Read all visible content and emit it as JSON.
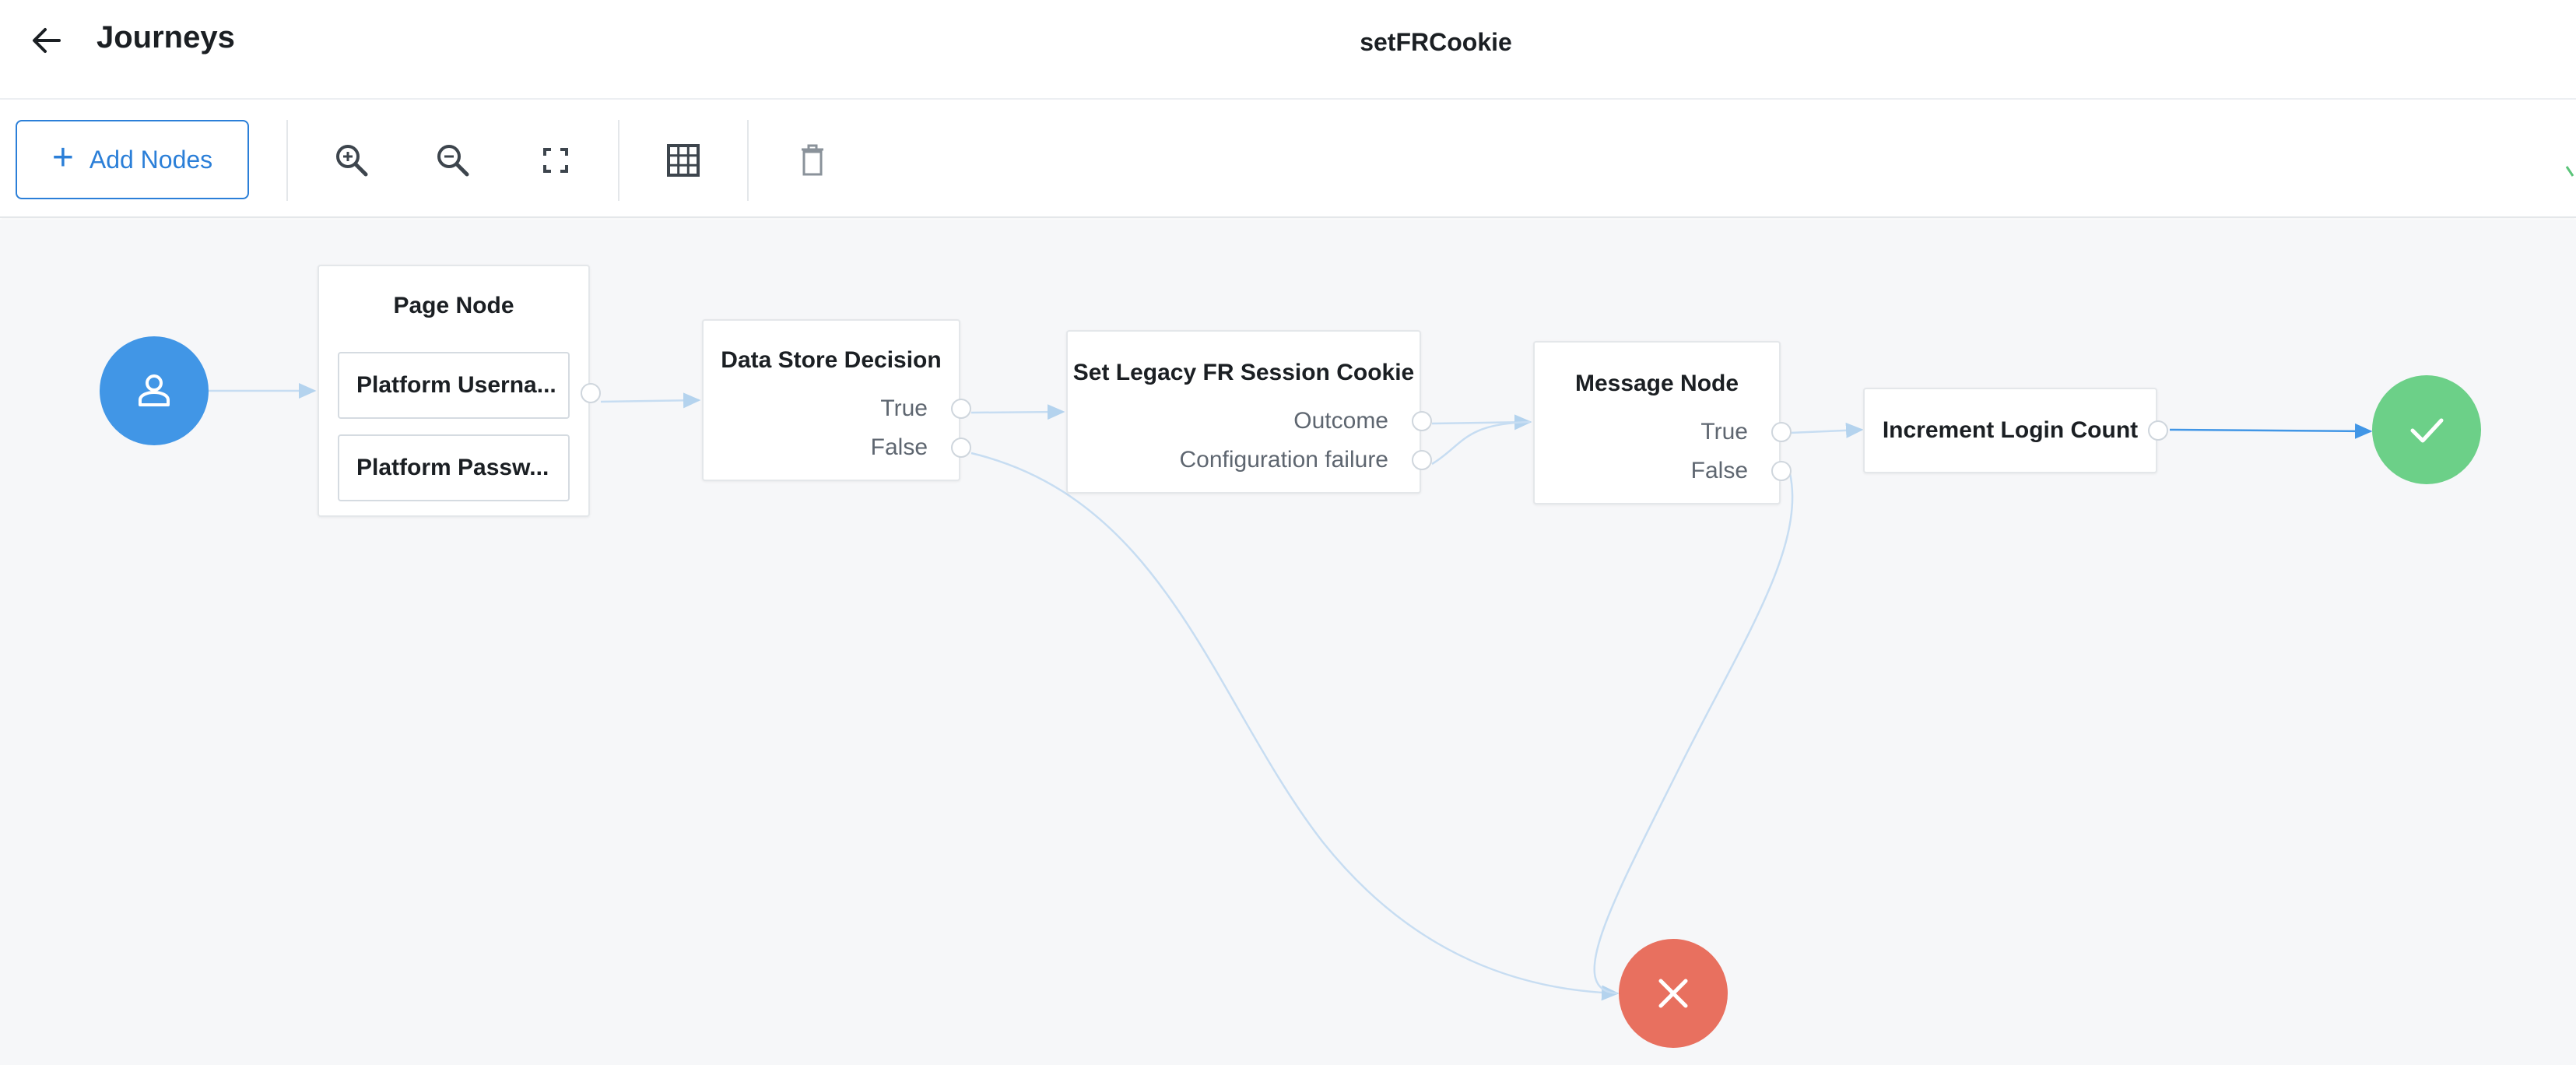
{
  "header": {
    "back_icon": "arrow-left-icon",
    "app_title": "Journeys",
    "journey_name": "setFRCookie"
  },
  "toolbar": {
    "add_nodes_label": "Add Nodes",
    "add_icon": "plus-icon",
    "icons": [
      "zoom-in-icon",
      "zoom-out-icon",
      "fit-screen-icon",
      "grid-icon",
      "trash-icon"
    ]
  },
  "canvas": {
    "start_node": {
      "icon": "user-icon"
    },
    "nodes": [
      {
        "title": "Page Node",
        "children": [
          "Platform Userna...",
          "Platform Passw..."
        ],
        "outcomes": []
      },
      {
        "title": "Data Store Decision",
        "outcomes": [
          "True",
          "False"
        ]
      },
      {
        "title": "Set Legacy FR Session Cookie",
        "outcomes": [
          "Outcome",
          "Configuration failure"
        ]
      },
      {
        "title": "Message Node",
        "outcomes": [
          "True",
          "False"
        ]
      },
      {
        "title": "Increment Login Count",
        "outcomes": []
      }
    ],
    "success_node": {
      "icon": "check-icon",
      "color": "#6cd088"
    },
    "failure_node": {
      "icon": "close-icon",
      "color": "#e8705f"
    }
  },
  "colors": {
    "accent": "#2b7fd8",
    "start": "#4196e6",
    "success": "#6cd088",
    "failure": "#e8705f",
    "connector": "#c7ddf2"
  }
}
